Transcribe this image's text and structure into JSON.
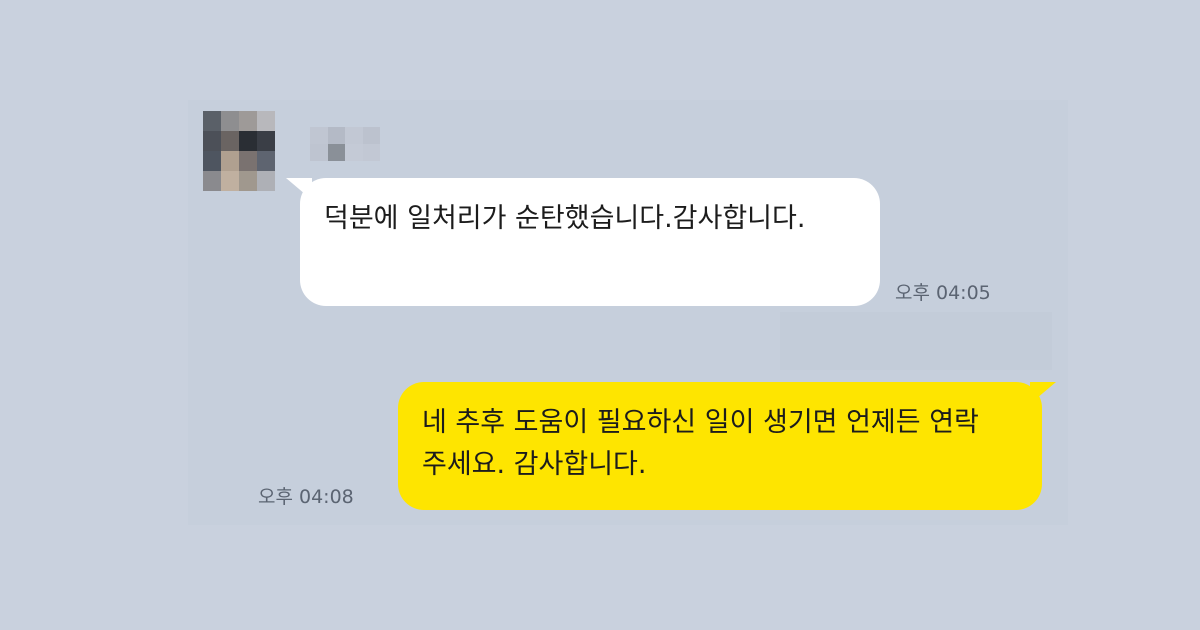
{
  "chat": {
    "incoming": {
      "text": "덕분에 일처리가 순탄했습니다.감사합니다.",
      "time": "오후 04:05"
    },
    "outgoing": {
      "text": "네 추후 도움이 필요하신 일이 생기면 언제든 연락 주세요. 감사합니다.",
      "time": "오후 04:08"
    }
  },
  "colors": {
    "background": "#c9d1de",
    "incoming_bubble": "#ffffff",
    "outgoing_bubble": "#fee500",
    "timestamp": "#5b6472"
  },
  "avatar_pixels": [
    "#5a6068",
    "#8e8e90",
    "#9e9a98",
    "#b8b8bc",
    "#4c5058",
    "#6a6462",
    "#2a2e34",
    "#3a3e46",
    "#4e5560",
    "#b0a090",
    "#7a7270",
    "#5e6470",
    "#8a8a8e",
    "#c0b0a0",
    "#a0988e",
    "#aeb0b6"
  ],
  "name_pixels": [
    "#c0c6d2",
    "#b4bac6",
    "#c2c8d4",
    "#bcc2ce",
    "#bec4d0",
    "#8a9098",
    "#c4cad6",
    "#c2c8d4"
  ]
}
